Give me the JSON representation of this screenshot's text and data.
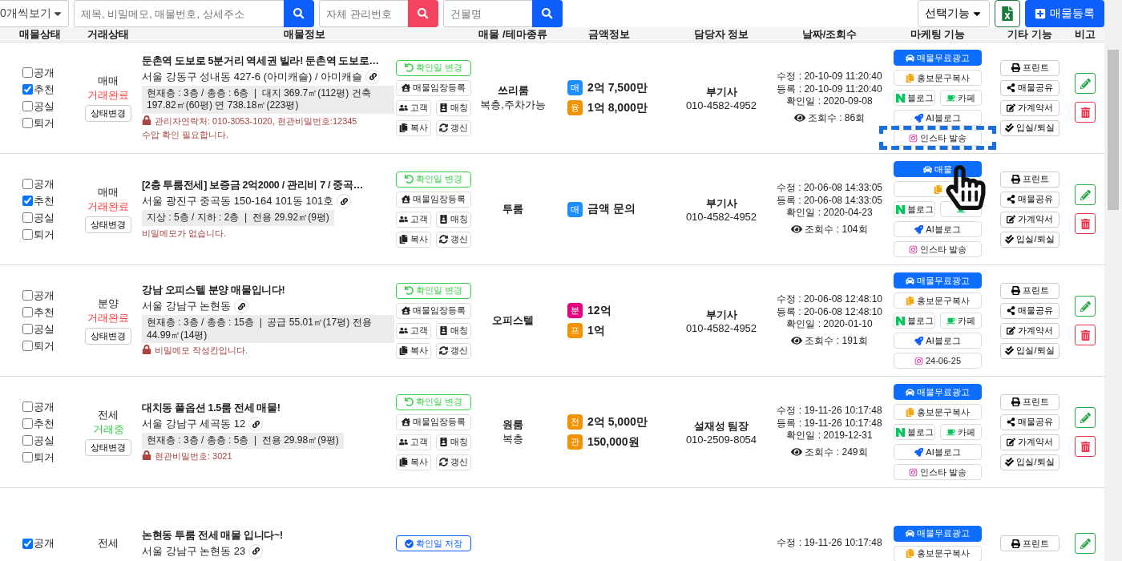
{
  "toolbar": {
    "page_size": "0개씩보기",
    "search_fields": [
      {
        "placeholder": "제목, 비밀메모, 매물번호, 상세주소",
        "kind": "primary"
      },
      {
        "placeholder": "자체 관리번호",
        "kind": "danger"
      },
      {
        "placeholder": "건물명",
        "kind": "primary"
      }
    ],
    "select_menu": "선택기능",
    "register_button": "매물등록"
  },
  "columns": [
    "매물상태",
    "거래상태",
    "매물정보",
    "매물 /테마종류",
    "금액정보",
    "담당자 정보",
    "날짜/조회수",
    "마케팅 기능",
    "기타 기능",
    "비고"
  ],
  "rows": [
    {
      "checks": [
        {
          "label": "공개",
          "checked": false
        },
        {
          "label": "추천",
          "checked": true
        },
        {
          "label": "공실",
          "checked": false
        },
        {
          "label": "퇴거",
          "checked": false
        }
      ],
      "deal_type": "매매",
      "deal_status": {
        "label": "거래완료",
        "color": "#ff3b3b"
      },
      "status_button": "상태변경",
      "title": "둔촌역 도보로 5분거리 역세권 빌라! 둔촌역 도보로…",
      "address": "서울 강동구 성내동 427-6 (아미캐슬) / 아미캐슬",
      "specs": "현재층 : 3층 / 총층 : 6층  |  대지 369.7㎡(112평) 건축 197.82㎡(60평) 연 738.18㎡(223평)",
      "memo": "관리자연락처: 010-3053-1020, 현관비밀번호:12345",
      "memo_extra": "수압 확인 필요합니다.",
      "locked": true,
      "confirm": {
        "label": "확인일 변경",
        "kind": "change"
      },
      "tools": [
        "매물임장등록",
        "고객",
        "매칭",
        "복사",
        "갱신"
      ],
      "category": "쓰리룸",
      "category_sub": "복층,주차가능",
      "prices": [
        {
          "tag": "매",
          "color": "#1e8fff",
          "amount": "2억 7,500만"
        },
        {
          "tag": "융",
          "color": "#f39200",
          "amount": "1억 8,000만"
        }
      ],
      "agent": "부기사",
      "phone": "010-4582-4952",
      "dates": [
        "수정 : 20-10-09 11:20:40",
        "등록 : 20-10-09 11:20:40",
        "확인일 : 2020-09-08"
      ],
      "views": "조회수 : 86회",
      "marketing": [
        {
          "label": "매물무료광고",
          "kind": "ad"
        },
        {
          "label": "홍보문구복사",
          "kind": "copy"
        },
        {
          "label": "블로그",
          "kind": "blog"
        },
        {
          "label": "카페",
          "kind": "cafe"
        },
        {
          "label": "AI블로그",
          "kind": "ai"
        },
        {
          "label": "인스타 발송",
          "kind": "insta"
        }
      ],
      "pointer": true,
      "etc": [
        {
          "label": "프린트",
          "kind": "print"
        },
        {
          "label": "매물공유",
          "kind": "share"
        },
        {
          "label": "가계약서",
          "kind": "contract"
        },
        {
          "label": "입실/퇴실",
          "kind": "checkin"
        }
      ],
      "actions": [
        {
          "kind": "edit"
        },
        {
          "kind": "delete"
        }
      ]
    },
    {
      "checks": [
        {
          "label": "공개",
          "checked": false
        },
        {
          "label": "추천",
          "checked": true
        },
        {
          "label": "공실",
          "checked": false
        },
        {
          "label": "퇴거",
          "checked": false
        }
      ],
      "deal_type": "매매",
      "deal_status": {
        "label": "거래완료",
        "color": "#ff3b3b"
      },
      "status_button": "상태변경",
      "title": "[2층 투룸전세] 보증금 2억2000 / 관리비 7 / 중곡…",
      "address": "서울 광진구 중곡동 150-164 101동 101호",
      "specs": "지상 : 5층 / 지하 : 2층  |  전용 29.92㎡(9평)",
      "memo": "비밀메모가 없습니다.",
      "confirm": {
        "label": "확인일 변경",
        "kind": "change"
      },
      "tools": [
        "매물임장등록",
        "고객",
        "매칭",
        "복사",
        "갱신"
      ],
      "category": "투룸",
      "prices": [
        {
          "tag": "매",
          "color": "#1e8fff",
          "amount": "금액 문의"
        }
      ],
      "agent": "부기사",
      "phone": "010-4582-4952",
      "dates": [
        "수정 : 20-06-08 14:33:05",
        "등록 : 20-06-08 14:33:05",
        "확인일 : 2020-04-23"
      ],
      "views": "조회수 : 104회",
      "marketing": [
        {
          "label": "매물",
          "kind": "ad"
        },
        {
          "kind": "copy"
        },
        {
          "label": "블로그",
          "kind": "blog"
        },
        {
          "kind": "cafe"
        },
        {
          "label": "AI블로그",
          "kind": "ai"
        },
        {
          "label": "인스타 발송",
          "kind": "insta"
        }
      ],
      "etc": [
        {
          "label": "프린트",
          "kind": "print"
        },
        {
          "label": "매물공유",
          "kind": "share"
        },
        {
          "label": "가계약서",
          "kind": "contract"
        },
        {
          "label": "입실/퇴실",
          "kind": "checkin"
        }
      ],
      "actions": [
        {
          "kind": "edit"
        },
        {
          "kind": "delete"
        }
      ]
    },
    {
      "checks": [
        {
          "label": "공개",
          "checked": false
        },
        {
          "label": "추천",
          "checked": false
        },
        {
          "label": "공실",
          "checked": false
        },
        {
          "label": "퇴거",
          "checked": false
        }
      ],
      "deal_type": "분양",
      "deal_status": {
        "label": "거래완료",
        "color": "#ff3b3b"
      },
      "status_button": "상태변경",
      "title": "강남 오피스텔 분양 매물입니다!",
      "address": "서울 강남구 논현동",
      "specs": "현재층 : 3층 / 총층 : 15층  |  공급 55.01㎡(17평) 전용 44.99㎡(14평)",
      "memo": "비밀메모 작성칸입니다.",
      "locked": true,
      "confirm": {
        "label": "확인일 변경",
        "kind": "change"
      },
      "tools": [
        "매물임장등록",
        "고객",
        "매칭",
        "복사",
        "갱신"
      ],
      "category": "오피스텔",
      "prices": [
        {
          "tag": "분",
          "color": "#e5007e",
          "amount": "12억"
        },
        {
          "tag": "프",
          "color": "#f39200",
          "amount": "1억"
        }
      ],
      "agent": "부기사",
      "phone": "010-4582-4952",
      "dates": [
        "수정 : 20-06-08 12:48:10",
        "등록 : 20-06-08 12:48:10",
        "확인일 : 2020-01-10"
      ],
      "views": "조회수 : 191회",
      "marketing": [
        {
          "label": "매물무료광고",
          "kind": "ad"
        },
        {
          "label": "홍보문구복사",
          "kind": "copy"
        },
        {
          "label": "블로그",
          "kind": "blog"
        },
        {
          "label": "카페",
          "kind": "cafe"
        },
        {
          "label": "AI블로그",
          "kind": "ai"
        },
        {
          "label": "24-06-25",
          "kind": "insta"
        }
      ],
      "etc": [
        {
          "label": "프린트",
          "kind": "print"
        },
        {
          "label": "매물공유",
          "kind": "share"
        },
        {
          "label": "가계약서",
          "kind": "contract"
        },
        {
          "label": "입실/퇴실",
          "kind": "checkin"
        }
      ],
      "actions": [
        {
          "kind": "edit"
        },
        {
          "kind": "delete"
        }
      ]
    },
    {
      "checks": [
        {
          "label": "공개",
          "checked": false
        },
        {
          "label": "추천",
          "checked": false
        },
        {
          "label": "공실",
          "checked": false
        },
        {
          "label": "퇴거",
          "checked": false
        }
      ],
      "deal_type": "전세",
      "deal_status": {
        "label": "거래중",
        "color": "#2ecc40"
      },
      "status_button": "상태변경",
      "title": "대치동 풀옵션 1.5룸 전세 매물!",
      "address": "서울 강남구 세곡동 12",
      "specs": "현재층 : 3층 / 총층 : 5층  |  전용 29.98㎡(9평)",
      "memo": "현관비밀번호: 3021",
      "locked": true,
      "confirm": {
        "label": "확인일 변경",
        "kind": "change"
      },
      "tools": [
        "매물임장등록",
        "고객",
        "매칭",
        "복사",
        "갱신"
      ],
      "category": "원룸",
      "category_sub": "복층",
      "prices": [
        {
          "tag": "전",
          "color": "#f39200",
          "amount": "2억 5,000만"
        },
        {
          "tag": "관",
          "color": "#f39200",
          "amount": "150,000원"
        }
      ],
      "agent": "설재성 팀장",
      "phone": "010-2509-8054",
      "dates": [
        "수정 : 19-11-26 10:17:48",
        "등록 : 19-11-26 10:17:48",
        "확인일 : 2019-12-31"
      ],
      "views": "조회수 : 249회",
      "marketing": [
        {
          "label": "매물무료광고",
          "kind": "ad"
        },
        {
          "label": "홍보문구복사",
          "kind": "copy"
        },
        {
          "label": "블로그",
          "kind": "blog"
        },
        {
          "label": "카페",
          "kind": "cafe"
        },
        {
          "label": "AI블로그",
          "kind": "ai"
        },
        {
          "label": "인스타 발송",
          "kind": "insta"
        }
      ],
      "etc": [
        {
          "label": "프린트",
          "kind": "print"
        },
        {
          "label": "매물공유",
          "kind": "share"
        },
        {
          "label": "가계약서",
          "kind": "contract"
        },
        {
          "label": "입실/퇴실",
          "kind": "checkin"
        }
      ],
      "actions": [
        {
          "kind": "edit"
        },
        {
          "kind": "delete"
        }
      ]
    },
    {
      "checks": [
        {
          "label": "공개",
          "checked": true
        }
      ],
      "deal_type": "전세",
      "title": "논현동 투룸 전세 매물 입니다~!",
      "address": "서울 강남구 논현동 23",
      "confirm": {
        "label": "확인일 저장",
        "kind": "save"
      },
      "dates": [
        "수정 : 19-11-26 10:17:48"
      ],
      "marketing": [
        {
          "label": "매물무료광고",
          "kind": "ad"
        },
        {
          "label": "홍보문구복사",
          "kind": "copy"
        }
      ],
      "etc": [
        {
          "label": "프린트",
          "kind": "print"
        }
      ],
      "actions": [
        {
          "kind": "edit"
        }
      ]
    }
  ]
}
